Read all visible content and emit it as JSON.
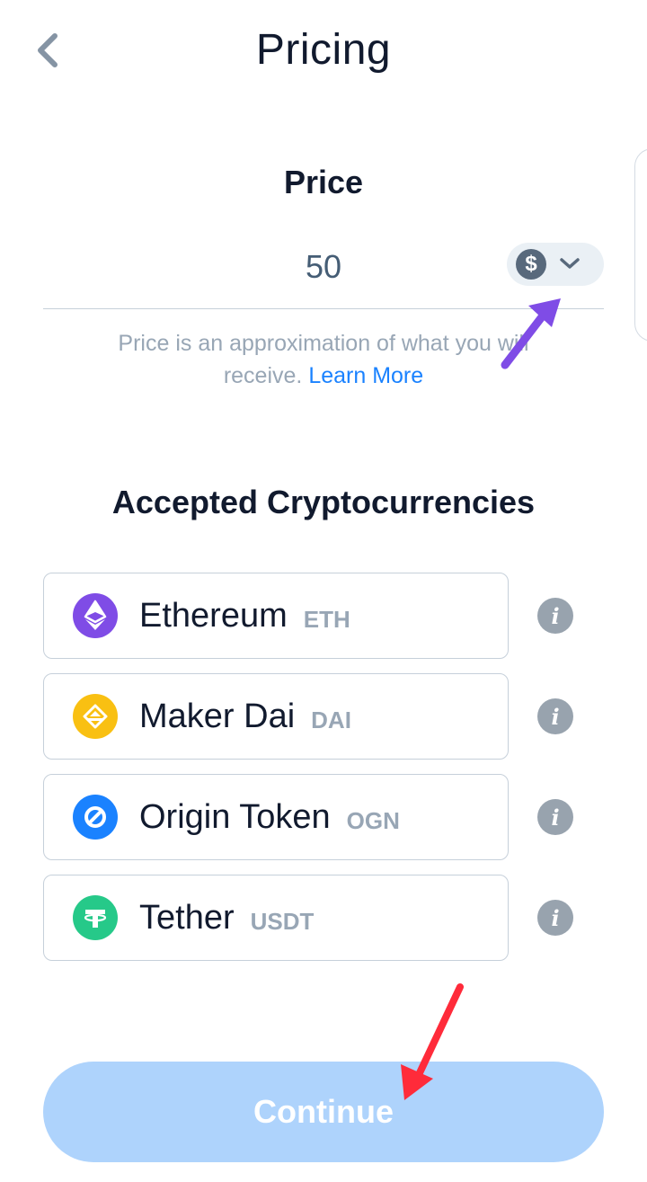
{
  "header": {
    "title": "Pricing",
    "back_icon": "chevron-left-icon"
  },
  "price": {
    "label": "Price",
    "value": "50",
    "currency_icon": "dollar-sign-icon",
    "currency_symbol": "$",
    "dropdown_icon": "chevron-down-icon",
    "note": "Price is an approximation of what you will receive.",
    "learn_more": "Learn More"
  },
  "accepted": {
    "title": "Accepted Cryptocurrencies",
    "items": [
      {
        "name": "Ethereum",
        "symbol": "ETH",
        "icon": "ethereum-icon",
        "color": "#7f4ce6"
      },
      {
        "name": "Maker Dai",
        "symbol": "DAI",
        "icon": "dai-icon",
        "color": "#f9c012"
      },
      {
        "name": "Origin Token",
        "symbol": "OGN",
        "icon": "origin-token-icon",
        "color": "#1a82ff"
      },
      {
        "name": "Tether",
        "symbol": "USDT",
        "icon": "tether-icon",
        "color": "#26c989"
      }
    ],
    "info_glyph": "i"
  },
  "continue_label": "Continue",
  "colors": {
    "accent": "#1a82ff",
    "continue_disabled": "#aed3fc",
    "annotation_purple": "#7f4ce6",
    "annotation_red": "#ff2b3a"
  }
}
